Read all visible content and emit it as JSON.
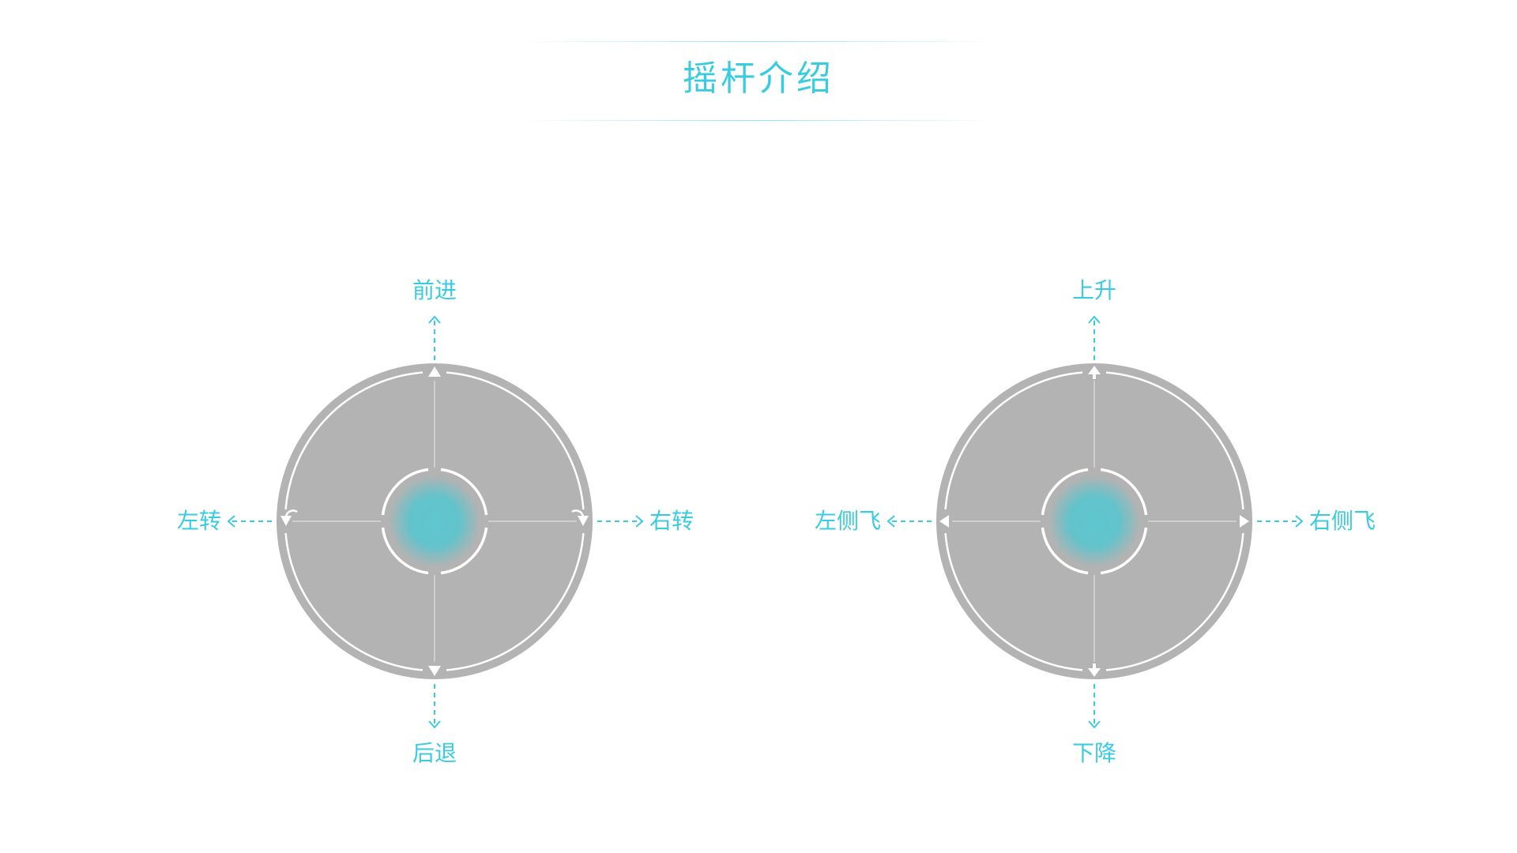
{
  "page": {
    "title": "摇杆介绍"
  },
  "colors": {
    "accent": "#39CCE0",
    "pad_fill": "#B3B3B3",
    "pad_ring": "#B3B3B3",
    "knob": "#5FC6CF",
    "line": "#FFFFFF"
  },
  "joysticks": [
    {
      "name": "left-joystick",
      "labels": {
        "up": "前进",
        "down": "后退",
        "left": "左转",
        "right": "右转"
      },
      "icons": {
        "up": "triangle-up-icon",
        "down": "triangle-down-icon",
        "left": "rotate-left-icon",
        "right": "rotate-right-icon"
      }
    },
    {
      "name": "right-joystick",
      "labels": {
        "up": "上升",
        "down": "下降",
        "left": "左侧飞",
        "right": "右侧飞"
      },
      "icons": {
        "up": "arrow-up-icon",
        "down": "arrow-down-icon",
        "left": "triangle-left-icon",
        "right": "triangle-right-icon"
      }
    }
  ]
}
